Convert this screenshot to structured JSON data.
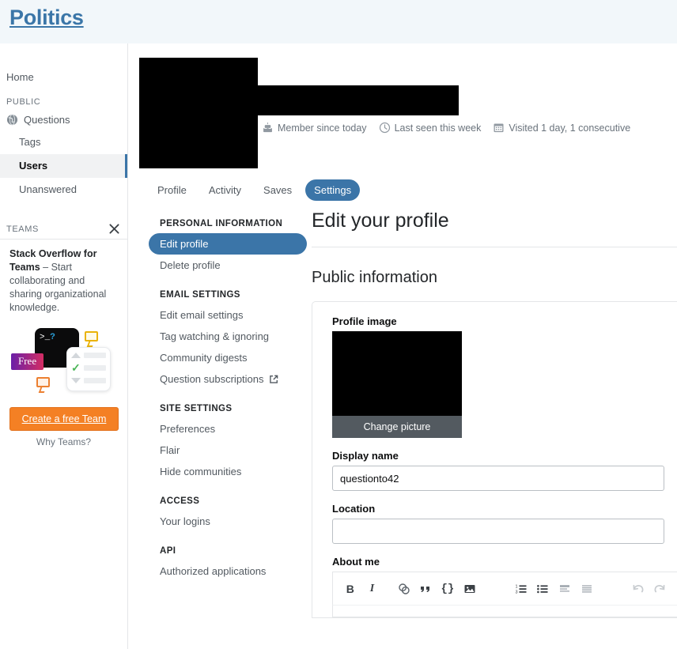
{
  "header": {
    "site_title": "Politics"
  },
  "sidebar": {
    "home_label": "Home",
    "public_title": "PUBLIC",
    "public_items": [
      {
        "label": "Questions",
        "icon": "globe-icon"
      },
      {
        "label": "Tags",
        "icon": null
      },
      {
        "label": "Users",
        "icon": null
      },
      {
        "label": "Unanswered",
        "icon": null
      }
    ],
    "active_item": "Users",
    "teams": {
      "title": "TEAMS",
      "close_icon": "close-icon",
      "blurb_bold": "Stack Overflow for Teams",
      "blurb_rest": " – Start collaborating and sharing organizational knowledge.",
      "art": {
        "terminal_prompt": ">_",
        "terminal_q": "?",
        "free_badge": "Free",
        "check": "✓"
      },
      "cta_label": "Create a free Team",
      "cta_color": "#f48024",
      "why_label": "Why Teams?"
    }
  },
  "profile": {
    "avatar": "redacted-avatar",
    "username": "redacted-username",
    "stats": [
      {
        "icon": "cake-icon",
        "text": "Member since today"
      },
      {
        "icon": "clock-icon",
        "text": "Last seen this week"
      },
      {
        "icon": "calendar-icon",
        "text": "Visited 1 day, 1 consecutive"
      }
    ]
  },
  "tabs": [
    {
      "label": "Profile",
      "active": false
    },
    {
      "label": "Activity",
      "active": false
    },
    {
      "label": "Saves",
      "active": false
    },
    {
      "label": "Settings",
      "active": true
    }
  ],
  "settings_nav": {
    "groups": [
      {
        "title": "PERSONAL INFORMATION",
        "items": [
          {
            "label": "Edit profile",
            "active": true,
            "external": false
          },
          {
            "label": "Delete profile",
            "active": false,
            "external": false
          }
        ]
      },
      {
        "title": "EMAIL SETTINGS",
        "items": [
          {
            "label": "Edit email settings",
            "active": false,
            "external": false
          },
          {
            "label": "Tag watching & ignoring",
            "active": false,
            "external": false
          },
          {
            "label": "Community digests",
            "active": false,
            "external": false
          },
          {
            "label": "Question subscriptions",
            "active": false,
            "external": true
          }
        ]
      },
      {
        "title": "SITE SETTINGS",
        "items": [
          {
            "label": "Preferences",
            "active": false,
            "external": false
          },
          {
            "label": "Flair",
            "active": false,
            "external": false
          },
          {
            "label": "Hide communities",
            "active": false,
            "external": false
          }
        ]
      },
      {
        "title": "ACCESS",
        "items": [
          {
            "label": "Your logins",
            "active": false,
            "external": false
          }
        ]
      },
      {
        "title": "API",
        "items": [
          {
            "label": "Authorized applications",
            "active": false,
            "external": false
          }
        ]
      }
    ]
  },
  "content": {
    "page_heading": "Edit your profile",
    "section_heading": "Public information",
    "profile_image_label": "Profile image",
    "change_picture_label": "Change picture",
    "display_name_label": "Display name",
    "display_name_value": "questionto42",
    "display_name_placeholder": "",
    "location_label": "Location",
    "location_value": "",
    "location_placeholder": "",
    "about_me_label": "About me",
    "editor_toolbar": [
      {
        "name": "bold-icon",
        "glyph": "B",
        "state": "normal"
      },
      {
        "name": "italic-icon",
        "glyph": "I",
        "state": "normal"
      },
      {
        "name": "link-icon",
        "glyph": "🔗",
        "state": "normal"
      },
      {
        "name": "blockquote-icon",
        "glyph": "”",
        "state": "normal"
      },
      {
        "name": "code-icon",
        "glyph": "{}",
        "state": "normal"
      },
      {
        "name": "image-icon",
        "glyph": "⛰",
        "state": "normal"
      },
      {
        "name": "numbered-list-icon",
        "glyph": "1.",
        "state": "normal"
      },
      {
        "name": "bulleted-list-icon",
        "glyph": "•",
        "state": "normal"
      },
      {
        "name": "heading-icon",
        "glyph": "≡",
        "state": "muted"
      },
      {
        "name": "horizontal-rule-icon",
        "glyph": "≡",
        "state": "muted"
      },
      {
        "name": "undo-icon",
        "glyph": "↶",
        "state": "disabled"
      },
      {
        "name": "redo-icon",
        "glyph": "↷",
        "state": "disabled"
      }
    ]
  }
}
